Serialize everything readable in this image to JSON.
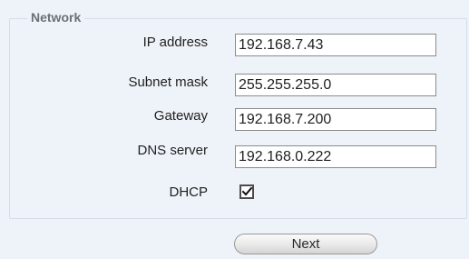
{
  "network": {
    "legend": "Network",
    "fields": [
      {
        "label": "IP address",
        "value": "192.168.7.43"
      },
      {
        "label": "Subnet mask",
        "value": "255.255.255.0"
      },
      {
        "label": "Gateway",
        "value": "192.168.7.200"
      },
      {
        "label": "DNS server",
        "value": "192.168.0.222"
      }
    ],
    "dhcp": {
      "label": "DHCP",
      "checked": true
    }
  },
  "actions": {
    "next_label": "Next"
  },
  "colors": {
    "background": "#eef3f9",
    "legend_text": "#6b6f76",
    "field_border": "#8b8b8b"
  }
}
